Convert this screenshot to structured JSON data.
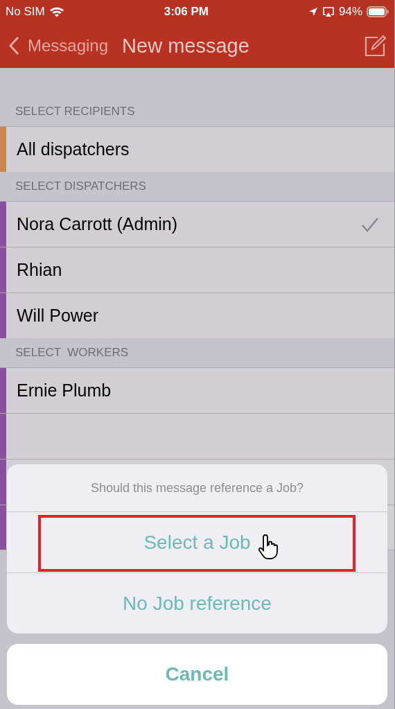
{
  "status_bar": {
    "carrier": "No SIM",
    "time": "3:06 PM",
    "battery": "94%"
  },
  "nav": {
    "back": "Messaging",
    "title": "New message"
  },
  "sections": [
    {
      "header": "SELECT RECIPIENTS",
      "rows": [
        {
          "name": "All dispatchers",
          "color": "#c98650",
          "checked": false
        }
      ]
    },
    {
      "header": "SELECT DISPATCHERS",
      "rows": [
        {
          "name": "Nora Carrott (Admin)",
          "color": "#8a4fa0",
          "checked": true
        },
        {
          "name": "Rhian",
          "color": "#8a4fa0",
          "checked": false
        },
        {
          "name": "Will Power",
          "color": "#8a4fa0",
          "checked": false
        }
      ]
    },
    {
      "header": "SELECT  WORKERS",
      "rows": [
        {
          "name": "Ernie Plumb",
          "color": "#8a4fa0",
          "checked": false
        },
        {
          "color": "#8a4fa0"
        },
        {
          "color": "#8a4fa0"
        },
        {
          "color": "#8a4fa0"
        }
      ]
    }
  ],
  "action_sheet": {
    "title": "Should this message reference a Job?",
    "actions": [
      {
        "label": "Select a Job",
        "highlighted": true
      },
      {
        "label": "No Job reference",
        "highlighted": false
      }
    ],
    "cancel": "Cancel"
  }
}
